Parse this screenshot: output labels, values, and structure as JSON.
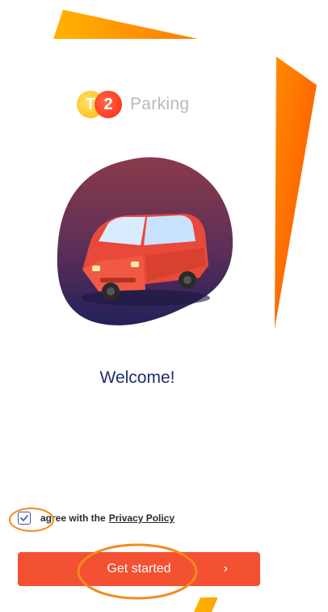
{
  "app": {
    "brand_t": "T",
    "brand_2": "2",
    "brand_name": "Parking"
  },
  "welcome": {
    "title": "Welcome!"
  },
  "consent": {
    "agree_text": "agree with the",
    "privacy_link": "Privacy Policy",
    "checked": true
  },
  "cta": {
    "label": "Get started",
    "arrow": "›"
  },
  "colors": {
    "accent": "#f35132",
    "title": "#1d2f6e",
    "annotation": "#f58a1f",
    "hero_top": "#8b3a4a",
    "hero_bottom": "#24205a"
  },
  "icons": {
    "checkbox": "check-icon",
    "cta_arrow": "chevron-right-icon",
    "hero": "car-illustration"
  }
}
